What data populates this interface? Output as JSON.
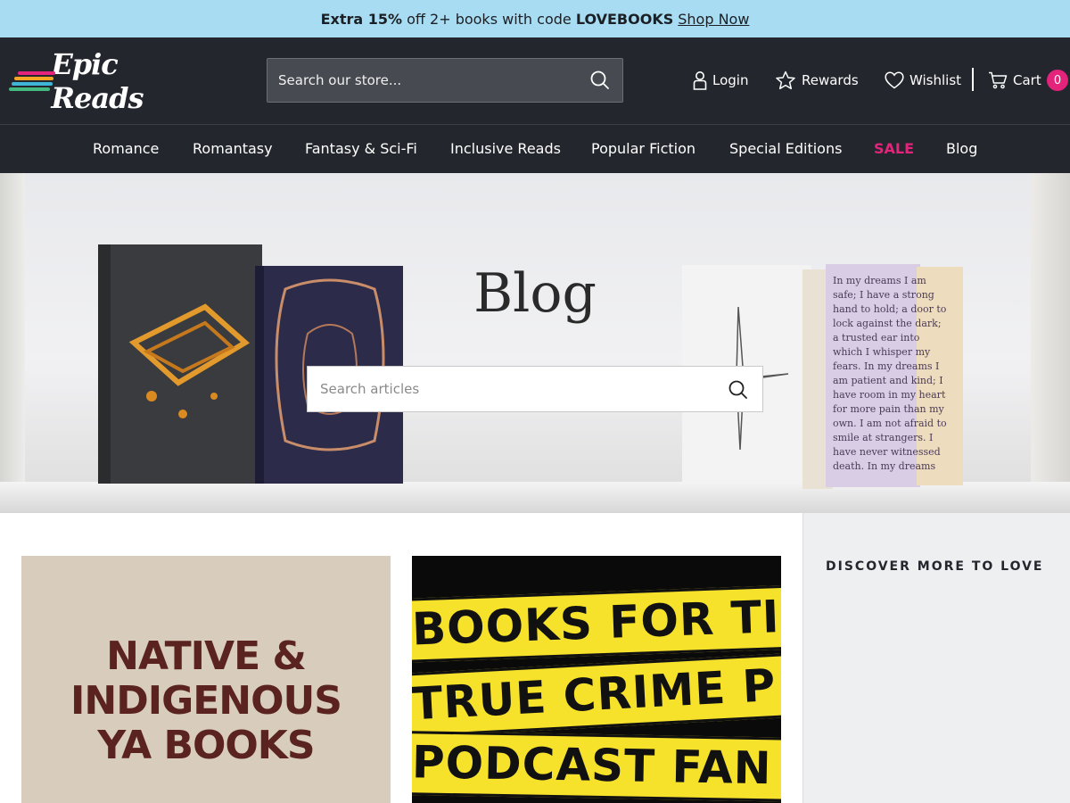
{
  "promo": {
    "part1_bold": "Extra 15%",
    "part2": " off 2+ books with code ",
    "code": "LOVEBOOKS",
    "link": "Shop Now"
  },
  "header": {
    "logo_text": "Epic Reads",
    "search_placeholder": "Search our store...",
    "login": "Login",
    "rewards": "Rewards",
    "wishlist": "Wishlist",
    "cart": "Cart",
    "cart_count": "0"
  },
  "nav": {
    "items": [
      "Romance",
      "Romantasy",
      "Fantasy & Sci-Fi",
      "Inclusive Reads",
      "Popular Fiction",
      "Special Editions",
      "SALE",
      "Blog"
    ]
  },
  "hero": {
    "title": "Blog",
    "search_placeholder": "Search articles"
  },
  "sidebar": {
    "heading": "DISCOVER MORE TO LOVE"
  },
  "cards": [
    {
      "lines": [
        "NATIVE &",
        "INDIGENOUS",
        "YA BOOKS"
      ]
    },
    {
      "lines": [
        "BOOKS FOR TI",
        "TRUE CRIME P",
        "PODCAST FAN"
      ]
    }
  ],
  "colors": {
    "promo_bg": "#a7dcf2",
    "header_bg": "#23262d",
    "sale": "#e3247a",
    "badge": "#e3247a"
  }
}
